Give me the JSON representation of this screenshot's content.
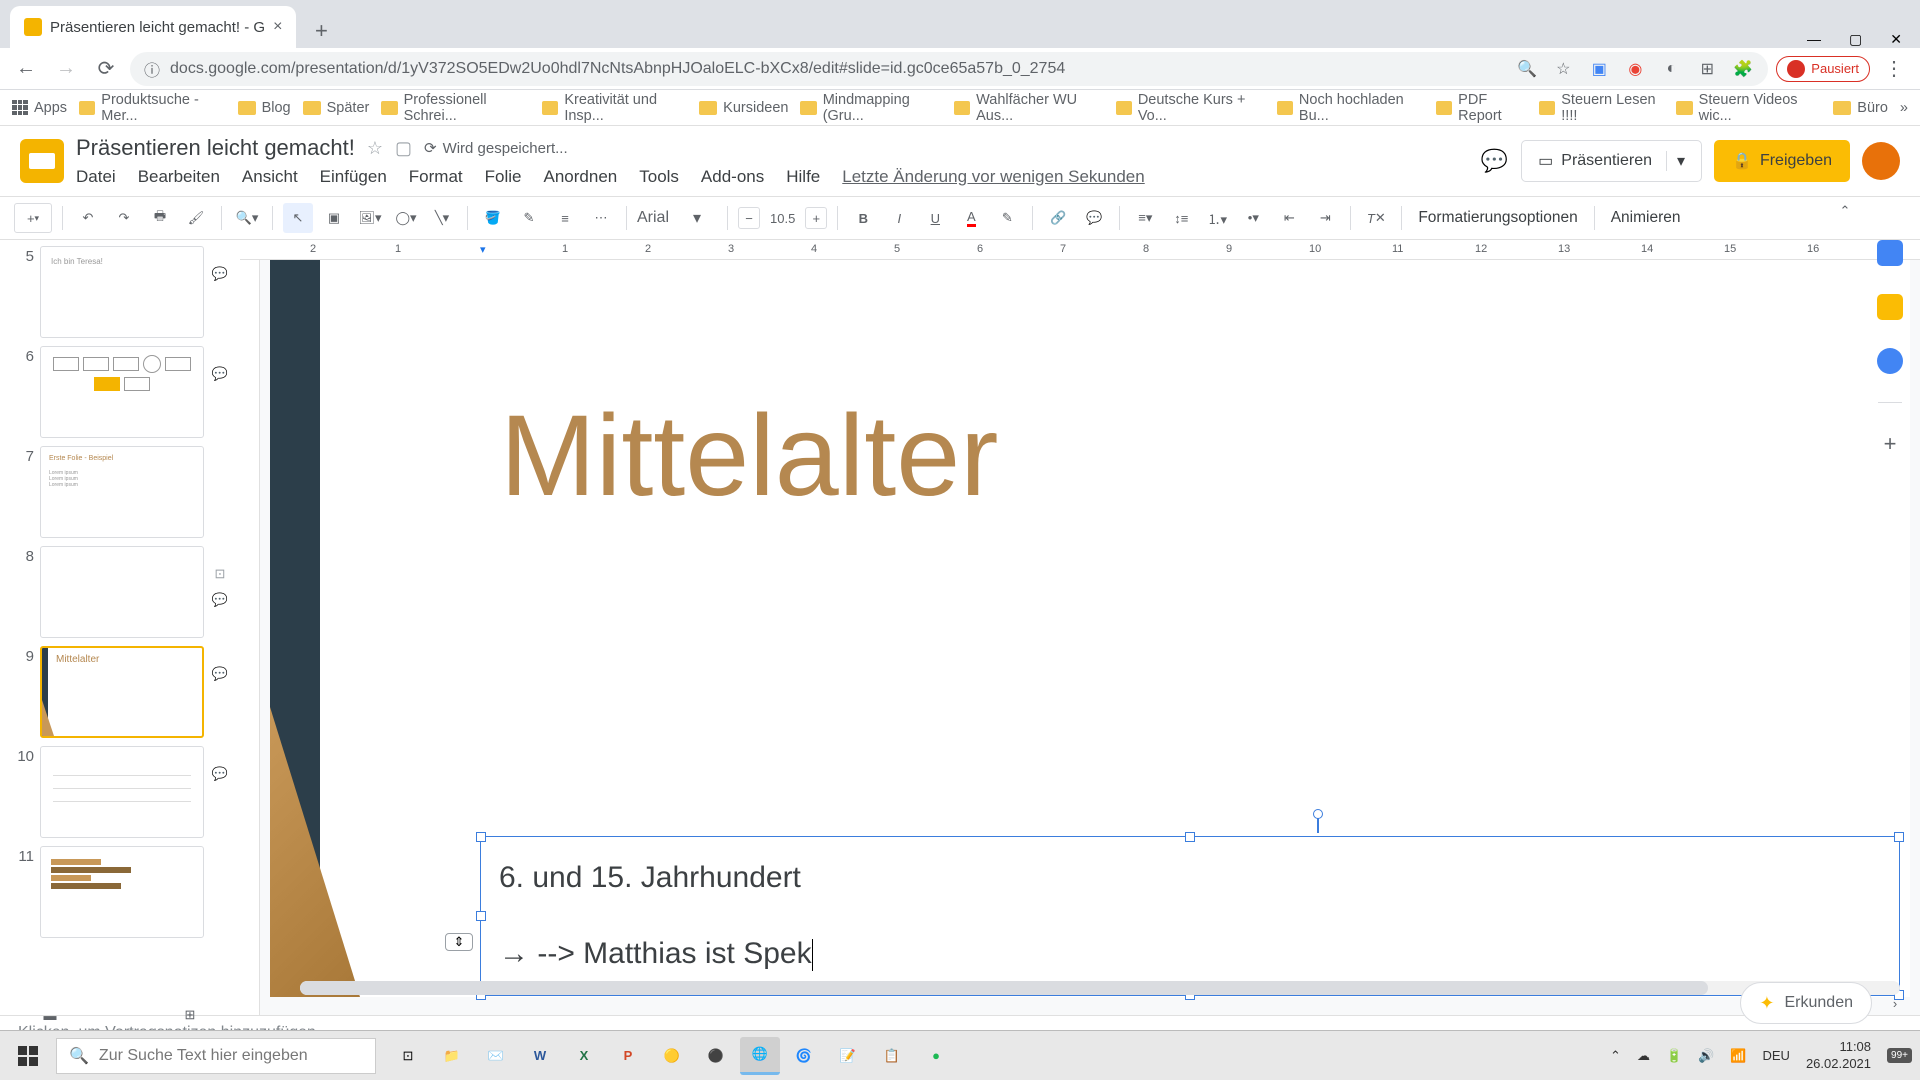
{
  "browser": {
    "tab_title": "Präsentieren leicht gemacht! - G",
    "url": "docs.google.com/presentation/d/1yV372SO5EDw2Uo0hdl7NcNtsAbnpHJOaloELC-bXCx8/edit#slide=id.gc0ce65a57b_0_2754",
    "paused": "Pausiert",
    "bookmarks": [
      "Apps",
      "Produktsuche - Mer...",
      "Blog",
      "Später",
      "Professionell Schrei...",
      "Kreativität und Insp...",
      "Kursideen",
      "Mindmapping  (Gru...",
      "Wahlfächer WU Aus...",
      "Deutsche Kurs + Vo...",
      "Noch hochladen Bu...",
      "PDF Report",
      "Steuern Lesen !!!!",
      "Steuern Videos wic...",
      "Büro"
    ]
  },
  "doc": {
    "title": "Präsentieren leicht gemacht!",
    "saving": "Wird gespeichert...",
    "last_edit": "Letzte Änderung vor wenigen Sekunden",
    "menus": [
      "Datei",
      "Bearbeiten",
      "Ansicht",
      "Einfügen",
      "Format",
      "Folie",
      "Anordnen",
      "Tools",
      "Add-ons",
      "Hilfe"
    ],
    "present": "Präsentieren",
    "share": "Freigeben"
  },
  "toolbar": {
    "font": "Arial",
    "font_size": "10.5",
    "format_options": "Formatierungsoptionen",
    "animate": "Animieren"
  },
  "slides": {
    "numbers": [
      "5",
      "6",
      "7",
      "8",
      "9",
      "10",
      "11"
    ],
    "selected": 4
  },
  "canvas": {
    "title": "Mittelalter",
    "line1": "6. und 15. Jahrhundert",
    "line2": "→ --> Matthias ist Spek"
  },
  "notes_placeholder": "Klicken, um Vortragsnotizen hinzuzufügen",
  "erkunden": "Erkunden",
  "ruler": [
    "2",
    "1",
    "",
    "1",
    "2",
    "3",
    "4",
    "5",
    "6",
    "7",
    "8",
    "9",
    "10",
    "11",
    "12",
    "13",
    "14",
    "15",
    "16"
  ],
  "taskbar": {
    "search_placeholder": "Zur Suche Text hier eingeben",
    "lang": "DEU",
    "time": "11:08",
    "date": "26.02.2021",
    "notif": "99+"
  }
}
